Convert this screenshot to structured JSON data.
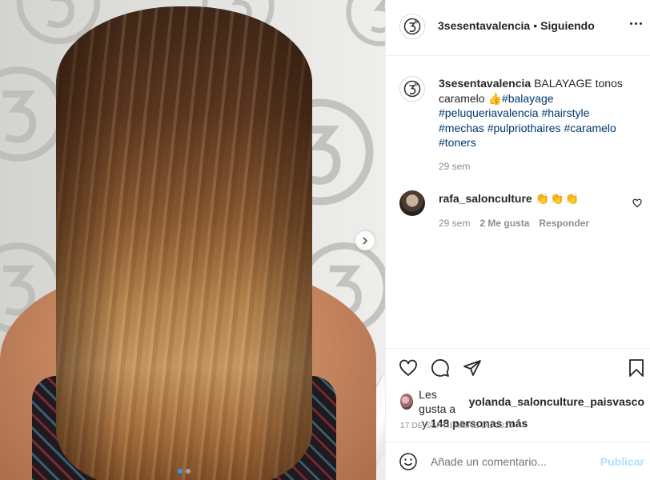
{
  "post": {
    "username": "3sesentavalencia",
    "separator": "•",
    "follow_status": "Siguiendo",
    "logo_icon": "3sesenta-logo-icon"
  },
  "caption": {
    "username": "3sesentavalencia",
    "text": "BALAYAGE tonos caramelo",
    "emoji": "👍",
    "hashtags": [
      "#balayage",
      "#peluqueriavalencia",
      "#hairstyle",
      "#mechas",
      "#pulpriothaires",
      "#caramelo",
      "#toners"
    ],
    "time": "29 sem"
  },
  "comment": {
    "username": "rafa_salonculture",
    "text": "👏👏👏",
    "time": "29 sem",
    "likes": "2 Me gusta",
    "reply": "Responder"
  },
  "likes": {
    "prefix": "Les gusta a",
    "user": "yolanda_salonculture_paisvasco",
    "connector": "y",
    "others": "148 personas más"
  },
  "date": "17 DE SEPTIEMBRE DE 2020",
  "add_comment": {
    "placeholder": "Añade un comentario...",
    "publish": "Publicar"
  },
  "carousel": {
    "slides": 2,
    "active_index": 0
  },
  "colors": {
    "link": "#00376b",
    "muted": "#8e8e8e",
    "publish": "#b2dffc",
    "carousel_active": "#3897f0"
  }
}
